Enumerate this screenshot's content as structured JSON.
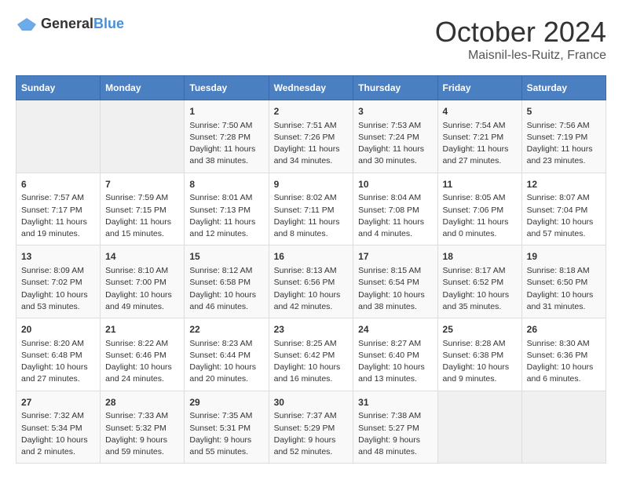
{
  "header": {
    "logo_general": "General",
    "logo_blue": "Blue",
    "month_title": "October 2024",
    "location": "Maisnil-les-Ruitz, France"
  },
  "weekdays": [
    "Sunday",
    "Monday",
    "Tuesday",
    "Wednesday",
    "Thursday",
    "Friday",
    "Saturday"
  ],
  "weeks": [
    [
      {
        "day": "",
        "info": ""
      },
      {
        "day": "",
        "info": ""
      },
      {
        "day": "1",
        "info": "Sunrise: 7:50 AM\nSunset: 7:28 PM\nDaylight: 11 hours and 38 minutes."
      },
      {
        "day": "2",
        "info": "Sunrise: 7:51 AM\nSunset: 7:26 PM\nDaylight: 11 hours and 34 minutes."
      },
      {
        "day": "3",
        "info": "Sunrise: 7:53 AM\nSunset: 7:24 PM\nDaylight: 11 hours and 30 minutes."
      },
      {
        "day": "4",
        "info": "Sunrise: 7:54 AM\nSunset: 7:21 PM\nDaylight: 11 hours and 27 minutes."
      },
      {
        "day": "5",
        "info": "Sunrise: 7:56 AM\nSunset: 7:19 PM\nDaylight: 11 hours and 23 minutes."
      }
    ],
    [
      {
        "day": "6",
        "info": "Sunrise: 7:57 AM\nSunset: 7:17 PM\nDaylight: 11 hours and 19 minutes."
      },
      {
        "day": "7",
        "info": "Sunrise: 7:59 AM\nSunset: 7:15 PM\nDaylight: 11 hours and 15 minutes."
      },
      {
        "day": "8",
        "info": "Sunrise: 8:01 AM\nSunset: 7:13 PM\nDaylight: 11 hours and 12 minutes."
      },
      {
        "day": "9",
        "info": "Sunrise: 8:02 AM\nSunset: 7:11 PM\nDaylight: 11 hours and 8 minutes."
      },
      {
        "day": "10",
        "info": "Sunrise: 8:04 AM\nSunset: 7:08 PM\nDaylight: 11 hours and 4 minutes."
      },
      {
        "day": "11",
        "info": "Sunrise: 8:05 AM\nSunset: 7:06 PM\nDaylight: 11 hours and 0 minutes."
      },
      {
        "day": "12",
        "info": "Sunrise: 8:07 AM\nSunset: 7:04 PM\nDaylight: 10 hours and 57 minutes."
      }
    ],
    [
      {
        "day": "13",
        "info": "Sunrise: 8:09 AM\nSunset: 7:02 PM\nDaylight: 10 hours and 53 minutes."
      },
      {
        "day": "14",
        "info": "Sunrise: 8:10 AM\nSunset: 7:00 PM\nDaylight: 10 hours and 49 minutes."
      },
      {
        "day": "15",
        "info": "Sunrise: 8:12 AM\nSunset: 6:58 PM\nDaylight: 10 hours and 46 minutes."
      },
      {
        "day": "16",
        "info": "Sunrise: 8:13 AM\nSunset: 6:56 PM\nDaylight: 10 hours and 42 minutes."
      },
      {
        "day": "17",
        "info": "Sunrise: 8:15 AM\nSunset: 6:54 PM\nDaylight: 10 hours and 38 minutes."
      },
      {
        "day": "18",
        "info": "Sunrise: 8:17 AM\nSunset: 6:52 PM\nDaylight: 10 hours and 35 minutes."
      },
      {
        "day": "19",
        "info": "Sunrise: 8:18 AM\nSunset: 6:50 PM\nDaylight: 10 hours and 31 minutes."
      }
    ],
    [
      {
        "day": "20",
        "info": "Sunrise: 8:20 AM\nSunset: 6:48 PM\nDaylight: 10 hours and 27 minutes."
      },
      {
        "day": "21",
        "info": "Sunrise: 8:22 AM\nSunset: 6:46 PM\nDaylight: 10 hours and 24 minutes."
      },
      {
        "day": "22",
        "info": "Sunrise: 8:23 AM\nSunset: 6:44 PM\nDaylight: 10 hours and 20 minutes."
      },
      {
        "day": "23",
        "info": "Sunrise: 8:25 AM\nSunset: 6:42 PM\nDaylight: 10 hours and 16 minutes."
      },
      {
        "day": "24",
        "info": "Sunrise: 8:27 AM\nSunset: 6:40 PM\nDaylight: 10 hours and 13 minutes."
      },
      {
        "day": "25",
        "info": "Sunrise: 8:28 AM\nSunset: 6:38 PM\nDaylight: 10 hours and 9 minutes."
      },
      {
        "day": "26",
        "info": "Sunrise: 8:30 AM\nSunset: 6:36 PM\nDaylight: 10 hours and 6 minutes."
      }
    ],
    [
      {
        "day": "27",
        "info": "Sunrise: 7:32 AM\nSunset: 5:34 PM\nDaylight: 10 hours and 2 minutes."
      },
      {
        "day": "28",
        "info": "Sunrise: 7:33 AM\nSunset: 5:32 PM\nDaylight: 9 hours and 59 minutes."
      },
      {
        "day": "29",
        "info": "Sunrise: 7:35 AM\nSunset: 5:31 PM\nDaylight: 9 hours and 55 minutes."
      },
      {
        "day": "30",
        "info": "Sunrise: 7:37 AM\nSunset: 5:29 PM\nDaylight: 9 hours and 52 minutes."
      },
      {
        "day": "31",
        "info": "Sunrise: 7:38 AM\nSunset: 5:27 PM\nDaylight: 9 hours and 48 minutes."
      },
      {
        "day": "",
        "info": ""
      },
      {
        "day": "",
        "info": ""
      }
    ]
  ]
}
